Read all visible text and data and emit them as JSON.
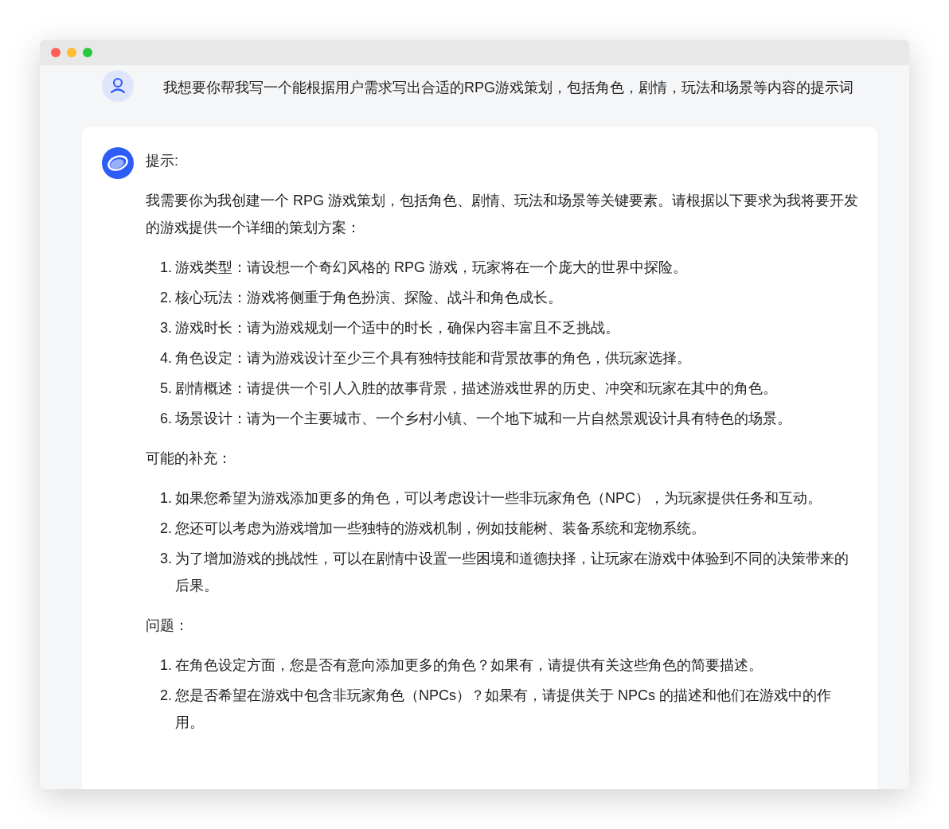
{
  "user_message": {
    "text": "我想要你帮我写一个能根据用户需求写出合适的RPG游戏策划，包括角色，剧情，玩法和场景等内容的提示词"
  },
  "reply": {
    "heading": "提示:",
    "intro": "我需要你为我创建一个 RPG 游戏策划，包括角色、剧情、玩法和场景等关键要素。请根据以下要求为我将要开发的游戏提供一个详细的策划方案：",
    "sections": [
      {
        "items": [
          {
            "number": "1.",
            "text": "游戏类型：请设想一个奇幻风格的 RPG 游戏，玩家将在一个庞大的世界中探险。"
          },
          {
            "number": "2.",
            "text": "核心玩法：游戏将侧重于角色扮演、探险、战斗和角色成长。"
          },
          {
            "number": "3.",
            "text": "游戏时长：请为游戏规划一个适中的时长，确保内容丰富且不乏挑战。"
          },
          {
            "number": "4.",
            "text": "角色设定：请为游戏设计至少三个具有独特技能和背景故事的角色，供玩家选择。"
          },
          {
            "number": "5.",
            "text": "剧情概述：请提供一个引人入胜的故事背景，描述游戏世界的历史、冲突和玩家在其中的角色。"
          },
          {
            "number": "6.",
            "text": "场景设计：请为一个主要城市、一个乡村小镇、一个地下城和一片自然景观设计具有特色的场景。"
          }
        ]
      },
      {
        "title": "可能的补充：",
        "items": [
          {
            "number": "1.",
            "text": "如果您希望为游戏添加更多的角色，可以考虑设计一些非玩家角色（NPC），为玩家提供任务和互动。"
          },
          {
            "number": "2.",
            "text": "您还可以考虑为游戏增加一些独特的游戏机制，例如技能树、装备系统和宠物系统。"
          },
          {
            "number": "3.",
            "text": "为了增加游戏的挑战性，可以在剧情中设置一些困境和道德抉择，让玩家在游戏中体验到不同的决策带来的后果。"
          }
        ]
      },
      {
        "title": "问题：",
        "items": [
          {
            "number": "1.",
            "text": "在角色设定方面，您是否有意向添加更多的角色？如果有，请提供有关这些角色的简要描述。"
          },
          {
            "number": "2.",
            "text": "您是否希望在游戏中包含非玩家角色（NPCs）？如果有，请提供关于 NPCs 的描述和他们在游戏中的作用。"
          }
        ]
      }
    ]
  }
}
